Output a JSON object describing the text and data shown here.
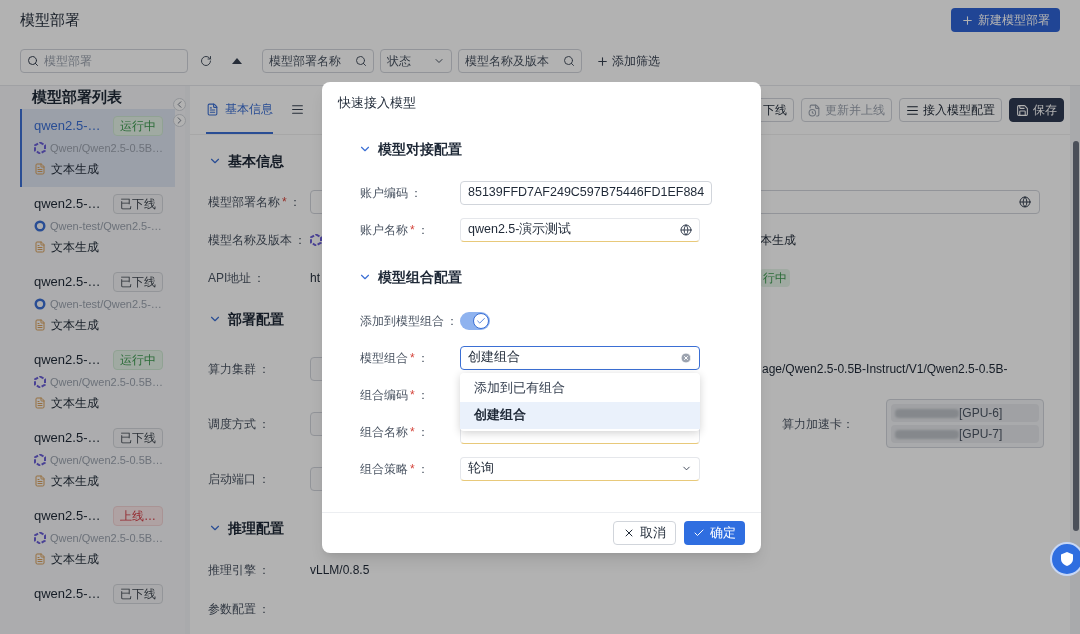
{
  "page": {
    "title": "模型部署",
    "new_button": "新建模型部署"
  },
  "filters": {
    "search_placeholder": "模型部署",
    "fields": [
      {
        "kind": "search",
        "placeholder": "模型部署名称"
      },
      {
        "kind": "select",
        "placeholder": "状态"
      },
      {
        "kind": "search",
        "placeholder": "模型名称及版本"
      }
    ],
    "add_filter": "添加筛选"
  },
  "sidebar": {
    "title": "模型部署列表",
    "items": [
      {
        "kind": "qwen",
        "name": "qwen2.5-…",
        "tag": {
          "label": "运行中",
          "kind": "running"
        },
        "model": "Qwen/Qwen2.5-0.5B…",
        "task": "文本生成",
        "selected": true
      },
      {
        "kind": "ring",
        "name": "qwen2.5-…",
        "tag": {
          "label": "已下线",
          "kind": "offline"
        },
        "model": "Qwen-test/Qwen2.5-…",
        "task": "文本生成",
        "selected": false
      },
      {
        "kind": "ring",
        "name": "qwen2.5-…",
        "tag": {
          "label": "已下线",
          "kind": "offline"
        },
        "model": "Qwen-test/Qwen2.5-…",
        "task": "文本生成",
        "selected": false
      },
      {
        "kind": "qwen",
        "name": "qwen2.5-…",
        "tag": {
          "label": "运行中",
          "kind": "running"
        },
        "model": "Qwen/Qwen2.5-0.5B…",
        "task": "文本生成",
        "selected": false
      },
      {
        "kind": "qwen",
        "name": "qwen2.5-…",
        "tag": {
          "label": "已下线",
          "kind": "offline"
        },
        "model": "Qwen/Qwen2.5-0.5B…",
        "task": "文本生成",
        "selected": false
      },
      {
        "kind": "qwen",
        "name": "qwen2.5-…",
        "tag": {
          "label": "上线…",
          "kind": "error"
        },
        "model": "Qwen/Qwen2.5-0.5B…",
        "task": "文本生成",
        "selected": false
      },
      {
        "name": "qwen2.5-…",
        "tag": {
          "label": "已下线",
          "kind": "offline"
        },
        "selected": false
      }
    ]
  },
  "tabs": [
    {
      "label": "基本信息",
      "selected": true
    },
    {
      "selected": false
    }
  ],
  "actions": [
    {
      "label": "下线",
      "kind": "offline",
      "disabled": false
    },
    {
      "label": "更新并上线",
      "kind": "update",
      "disabled": true
    },
    {
      "label": "接入模型配置",
      "kind": "config",
      "disabled": false
    },
    {
      "label": "保存",
      "kind": "save",
      "disabled": false
    }
  ],
  "sections": [
    {
      "title": "基本信息",
      "expanded": true,
      "rows": [
        {
          "kind": "wide-input",
          "label": "模型部署名称",
          "mark": "*",
          "colon": "："
        },
        {
          "kind": "text",
          "label": "模型名称及版本",
          "colon": "：",
          "value_icon": true,
          "tail": "本生成"
        },
        {
          "kind": "text",
          "label": "API地址",
          "colon": "：",
          "value": "ht",
          "tail_status": "行中"
        }
      ]
    },
    {
      "title": "部署配置",
      "expanded": true,
      "rows": [
        {
          "kind": "input",
          "label": "算力集群",
          "colon": "：",
          "tail": "age/Qwen2.5-0.5B-Instruct/V1/Qwen2.5-0.5B-"
        },
        {
          "kind": "input",
          "label": "调度方式",
          "colon": "：",
          "side_label": "算力加速卡：",
          "cards": [
            "[GPU-6]",
            "[GPU-7]"
          ]
        },
        {
          "kind": "input",
          "label": "启动端口",
          "colon": "："
        }
      ]
    },
    {
      "title": "推理配置",
      "expanded": true,
      "rows": [
        {
          "kind": "text",
          "label": "推理引擎",
          "colon": "：",
          "value": "vLLM/0.8.5"
        },
        {
          "kind": "text",
          "label": "参数配置",
          "colon": "："
        }
      ]
    }
  ],
  "modal": {
    "title": "快速接入模型",
    "sections": [
      {
        "title": "模型对接配置",
        "expanded": true,
        "rows": [
          {
            "kind": "input",
            "label": "账户编码",
            "colon": "：",
            "value": "85139FFD7AF249C597B75446FD1EF884"
          },
          {
            "kind": "input",
            "label": "账户名称",
            "mark": "*",
            "colon": "：",
            "value": "qwen2.5-演示测试",
            "globe": true
          }
        ]
      },
      {
        "title": "模型组合配置",
        "expanded": true,
        "rows": [
          {
            "kind": "switch",
            "label": "添加到模型组合",
            "colon": "：",
            "on": true
          },
          {
            "kind": "combo",
            "label": "模型组合",
            "mark": "*",
            "colon": "：",
            "value": "创建组合",
            "focused": true
          },
          {
            "kind": "hidden",
            "label": "组合编码",
            "mark": "*",
            "colon": "："
          },
          {
            "kind": "hidden",
            "label": "组合名称",
            "mark": "*",
            "colon": "："
          },
          {
            "kind": "select",
            "label": "组合策略",
            "mark": "*",
            "colon": "：",
            "value": "轮询"
          }
        ]
      }
    ],
    "dropdown": [
      {
        "label": "添加到已有组合",
        "selected": false
      },
      {
        "label": "创建组合",
        "selected": true
      }
    ],
    "buttons": [
      {
        "label": "取消",
        "kind": "cancel"
      },
      {
        "label": "确定",
        "kind": "ok"
      }
    ]
  }
}
